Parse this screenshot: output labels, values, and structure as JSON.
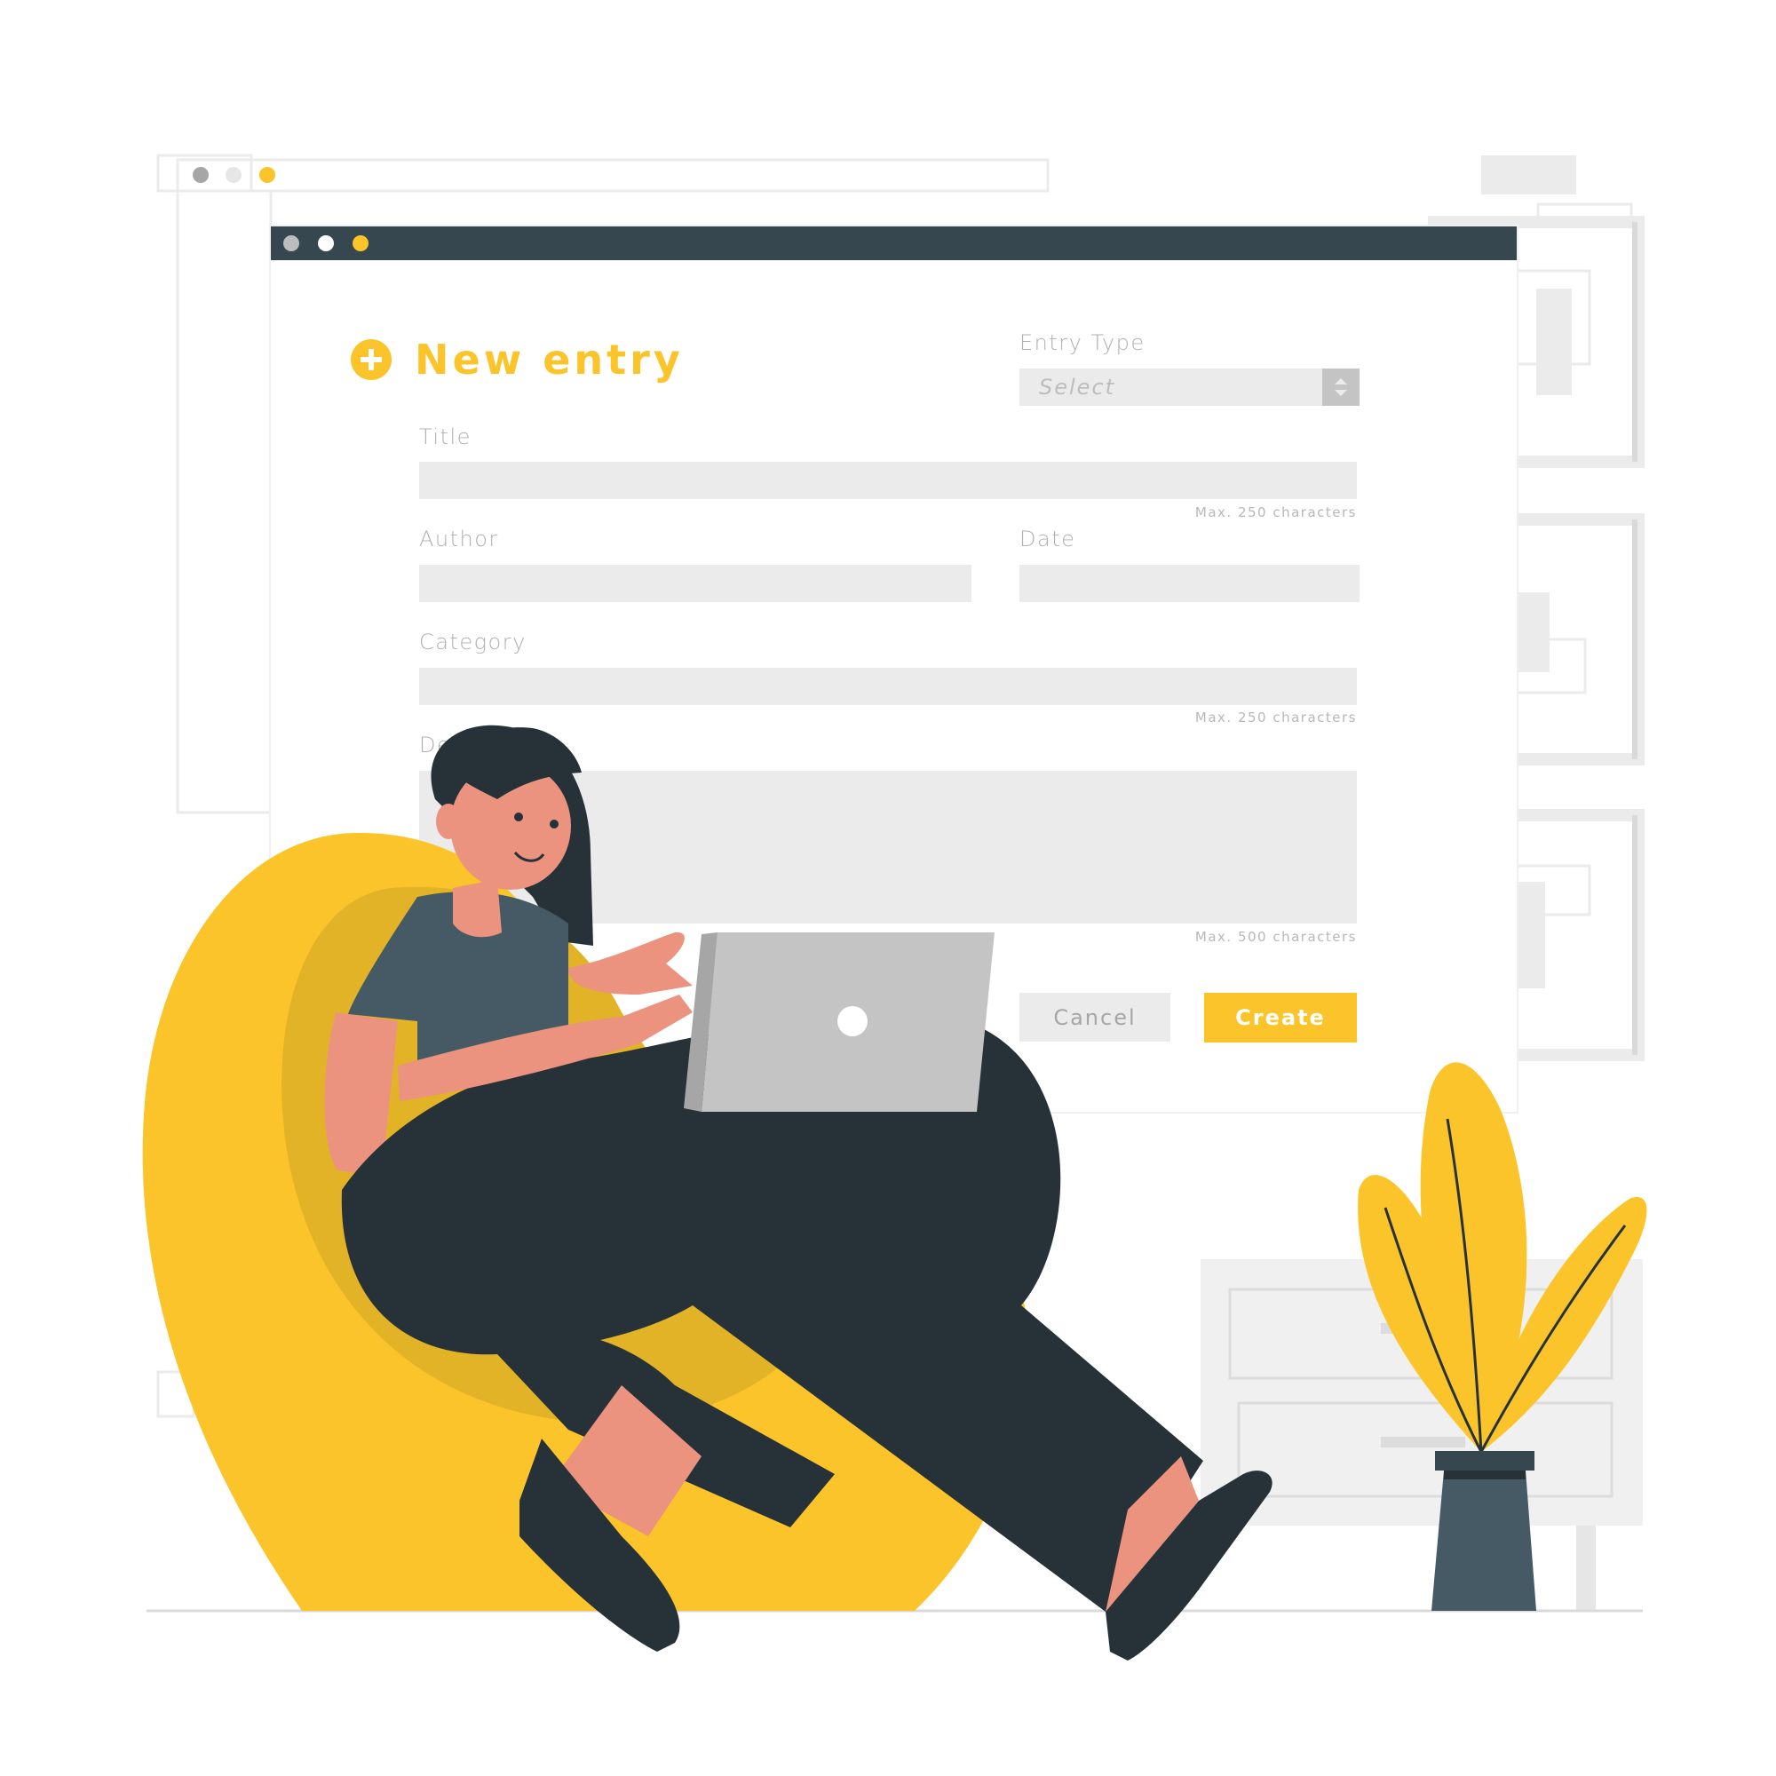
{
  "window": {
    "title_dots": [
      "dot-gray",
      "dot-white",
      "dot-yellow"
    ]
  },
  "form": {
    "heading": "New entry",
    "entry_type_label": "Entry Type",
    "entry_type_placeholder": "Select",
    "title_label": "Title",
    "title_hint": "Max. 250 characters",
    "author_label": "Author",
    "date_label": "Date",
    "category_label": "Category",
    "category_hint": "Max. 250 characters",
    "description_label": "Des",
    "description_hint": "Max. 500 characters",
    "cancel_label": "Cancel",
    "create_label": "Create"
  },
  "colors": {
    "accent": "#fbc42a",
    "titlebar": "#37474f",
    "field": "#ebebeb",
    "label": "#b0b0b0"
  },
  "icons": [
    "plus-circle-icon",
    "select-arrows-icon"
  ]
}
